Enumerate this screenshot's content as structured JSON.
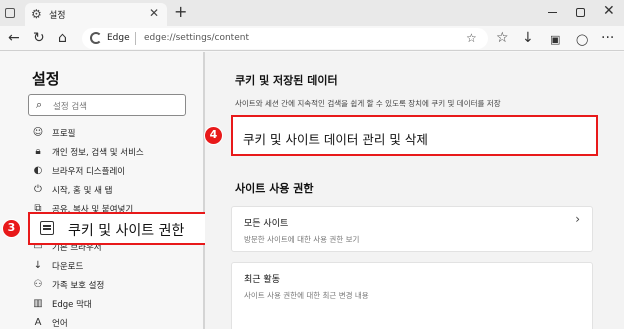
{
  "browser": {
    "tab_title": "설정",
    "new_tab": "+",
    "address_brand": "Edge",
    "address_url": "edge://settings/content"
  },
  "sidebar": {
    "title": "설정",
    "search_placeholder": "설정 검색",
    "items": [
      {
        "label": "프로필",
        "icon": "profile-icon"
      },
      {
        "label": "개인 정보, 검색 및 서비스",
        "icon": "lock-icon"
      },
      {
        "label": "브라우저 디스플레이",
        "icon": "display-icon"
      },
      {
        "label": "시작, 홈 및 새 탭",
        "icon": "power-icon"
      },
      {
        "label": "공유, 복사 및 붙여넣기",
        "icon": "share-icon"
      },
      {
        "label": "쿠키 및 사이트 권한",
        "icon": "cookie-site-icon"
      },
      {
        "label": "기본 브라우저",
        "icon": "browser-icon"
      },
      {
        "label": "다운로드",
        "icon": "download-icon"
      },
      {
        "label": "가족 보호 설정",
        "icon": "family-icon"
      },
      {
        "label": "Edge 막대",
        "icon": "edge-bar-icon"
      },
      {
        "label": "언어",
        "icon": "language-icon"
      }
    ]
  },
  "callouts": {
    "three": {
      "number": "3",
      "label": "쿠키 및 사이트 권한"
    },
    "four": {
      "number": "4",
      "label": "쿠키 및 사이트 데이터 관리 및 삭제"
    }
  },
  "main": {
    "cookies_title": "쿠키 및 저장된 데이터",
    "cookies_desc": "사이트와 세션 간에 지속적인 검색을 쉽게 할 수 있도록 장치에 쿠키 및 데이터를 저장",
    "permissions_title": "사이트 사용 권한",
    "cards": [
      {
        "title": "모든 사이트",
        "desc": "방문한 사이트에 대한 사용 권한 보기"
      },
      {
        "title": "최근 활동",
        "desc": "사이트 사용 권한에 대한 최근 변경 내용"
      }
    ]
  },
  "colors": {
    "callout_red": "#e8191a",
    "accent_blue": "#0f6cbd"
  }
}
